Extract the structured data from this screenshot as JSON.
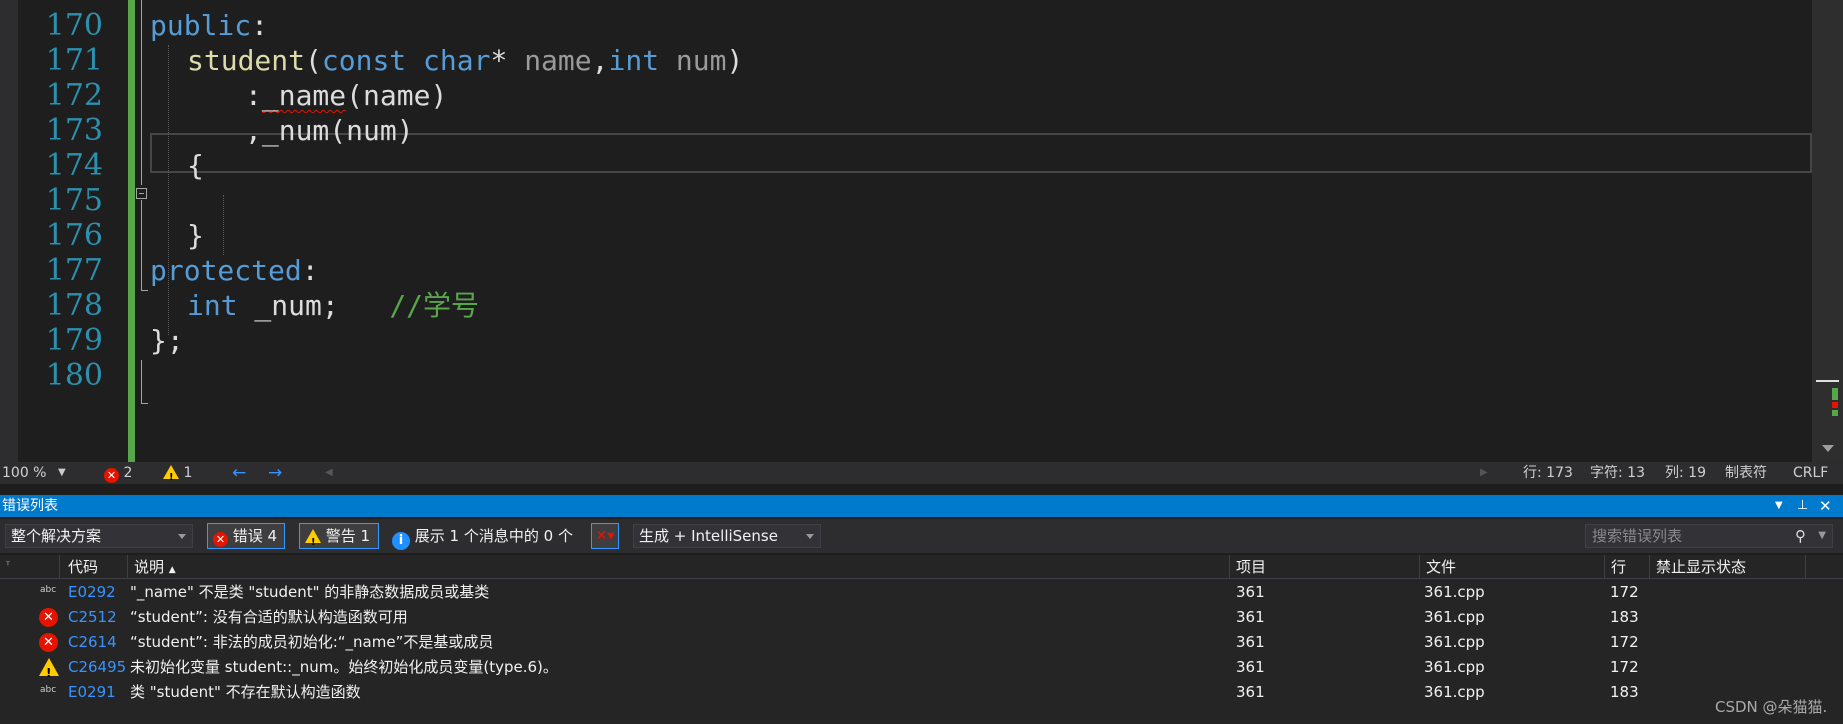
{
  "editor": {
    "line_numbers": [
      "170",
      "171",
      "172",
      "173",
      "174",
      "175",
      "176",
      "177",
      "178",
      "179",
      "180"
    ],
    "lines": {
      "l170_a": "public",
      "l170_b": ":",
      "l171_fn": "student",
      "l171_p1": "(",
      "l171_const": "const",
      "l171_char": "char",
      "l171_star": "* ",
      "l171_name": "name",
      "l171_comma": ",",
      "l171_int": "int",
      "l171_num": "num",
      "l171_p2": ")",
      "l172_colon": ":",
      "l172_member": "_name",
      "l172_arg": "(name)",
      "l173_text": ",_num(num)",
      "l174_text": "{",
      "l176_text": "}",
      "l177_a": "protected",
      "l177_b": ":",
      "l178_int": "int",
      "l178_var": " _num;",
      "l178_cm": "//学号",
      "l179_text": "};"
    }
  },
  "editor_status": {
    "zoom": "100 %",
    "error_count": "2",
    "warning_count": "1",
    "position_line": "行: 173",
    "position_char": "字符: 13",
    "position_col": "列: 19",
    "indent_mode": "制表符",
    "line_ending": "CRLF"
  },
  "error_list": {
    "title": "错误列表",
    "scope": "整个解决方案",
    "errors_btn": "错误 4",
    "warnings_btn": "警告 1",
    "messages_label": "展示 1 个消息中的 0 个",
    "build_filter": "生成 + IntelliSense",
    "search_placeholder": "搜索错误列表",
    "columns": {
      "code": "代码",
      "description": "说明",
      "project": "项目",
      "file": "文件",
      "line": "行",
      "suppression": "禁止显示状态"
    },
    "rows": [
      {
        "icon": "spelling-error-icon",
        "code": "E0292",
        "description": "\"_name\" 不是类 \"student\" 的非静态数据成员或基类",
        "project": "361",
        "file": "361.cpp",
        "line": "172"
      },
      {
        "icon": "error-icon",
        "code": "C2512",
        "description": "“student”: 没有合适的默认构造函数可用",
        "project": "361",
        "file": "361.cpp",
        "line": "183"
      },
      {
        "icon": "error-icon",
        "code": "C2614",
        "description": "“student”: 非法的成员初始化:“_name”不是基或成员",
        "project": "361",
        "file": "361.cpp",
        "line": "172"
      },
      {
        "icon": "warning-icon",
        "code": "C26495",
        "description": "未初始化变量 student::_num。始终初始化成员变量(type.6)。",
        "project": "361",
        "file": "361.cpp",
        "line": "172"
      },
      {
        "icon": "spelling-error-icon",
        "code": "E0291",
        "description": "类 \"student\" 不存在默认构造函数",
        "project": "361",
        "file": "361.cpp",
        "line": "183"
      }
    ]
  },
  "watermark": "CSDN @朵猫猫.",
  "colors": {
    "keyword": "#569cd6",
    "function": "#dcdcaa",
    "comment": "#57a64a",
    "line_number": "#2b91af",
    "accent": "#007acc",
    "error": "#e51400",
    "warning": "#ffcc00"
  }
}
